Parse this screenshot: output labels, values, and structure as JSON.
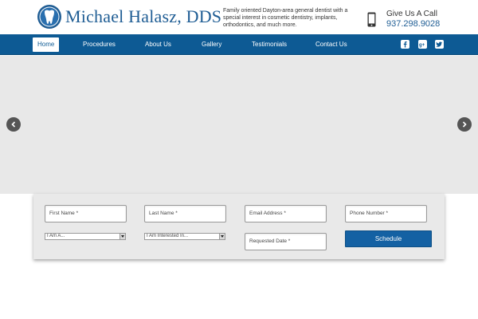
{
  "header": {
    "logo_text": "Michael Halasz, DDS",
    "tagline": "Family oriented Dayton-area general dentist with a special interest in cosmetic dentistry, implants, orthodontics, and much more.",
    "call_label": "Give Us A Call",
    "call_number": "937.298.9028"
  },
  "nav": {
    "items": [
      {
        "label": "Home",
        "active": true
      },
      {
        "label": "Procedures"
      },
      {
        "label": "About Us"
      },
      {
        "label": "Gallery"
      },
      {
        "label": "Testimonials"
      },
      {
        "label": "Contact Us"
      }
    ],
    "social_icons": [
      "facebook-icon",
      "google-plus-icon",
      "twitter-icon"
    ]
  },
  "form": {
    "first_name_placeholder": "First Name *",
    "last_name_placeholder": "Last Name *",
    "email_placeholder": "Email Address *",
    "phone_placeholder": "Phone Number *",
    "i_am_value": "I Am A...",
    "interested_value": "I Am Interested In...",
    "requested_date_placeholder": "Requested Date *",
    "schedule_label": "Schedule"
  },
  "colors": {
    "brand_blue": "#0d5a94",
    "logo_blue": "#1f5d94",
    "button_blue": "#1461a3",
    "slider_bg": "#e8e8e8"
  }
}
